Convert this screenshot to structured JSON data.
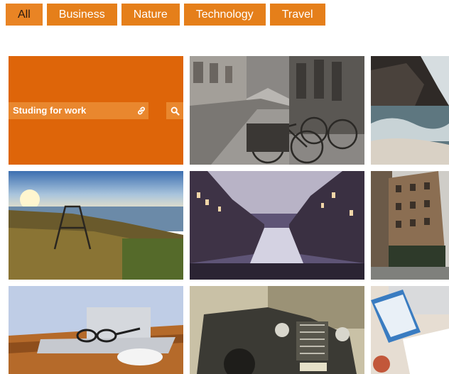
{
  "filters": [
    {
      "label": "All",
      "active": true
    },
    {
      "label": "Business",
      "active": false
    },
    {
      "label": "Nature",
      "active": false
    },
    {
      "label": "Technology",
      "active": false
    },
    {
      "label": "Travel",
      "active": false
    }
  ],
  "portfolio": {
    "hover_item": {
      "title": "Studing for work",
      "link_icon": "link-icon",
      "zoom_icon": "search-icon"
    },
    "items": [
      {
        "name": "studing-for-work",
        "subject": "orange hover overlay"
      },
      {
        "name": "city-street-bicycles",
        "subject": "bicycles parked on a wet city street"
      },
      {
        "name": "rocky-coast-waves",
        "subject": "waves crashing on a rocky coast"
      },
      {
        "name": "lake-sunset-grass",
        "subject": "grassy lakeshore with a wooden frame at sunset"
      },
      {
        "name": "canal-buildings-dusk",
        "subject": "canal between buildings at dusk"
      },
      {
        "name": "city-corner-building",
        "subject": "tall building on a city corner"
      },
      {
        "name": "desk-laptop-glasses",
        "subject": "wooden desk with laptop, glasses and mouse"
      },
      {
        "name": "vintage-car-street",
        "subject": "vintage car on a street"
      },
      {
        "name": "desk-books-notebook",
        "subject": "desk with books and a notebook"
      }
    ]
  },
  "colors": {
    "accent": "#e57f1a",
    "overlay": "#de6509",
    "caption_bg": "#e9872e"
  }
}
